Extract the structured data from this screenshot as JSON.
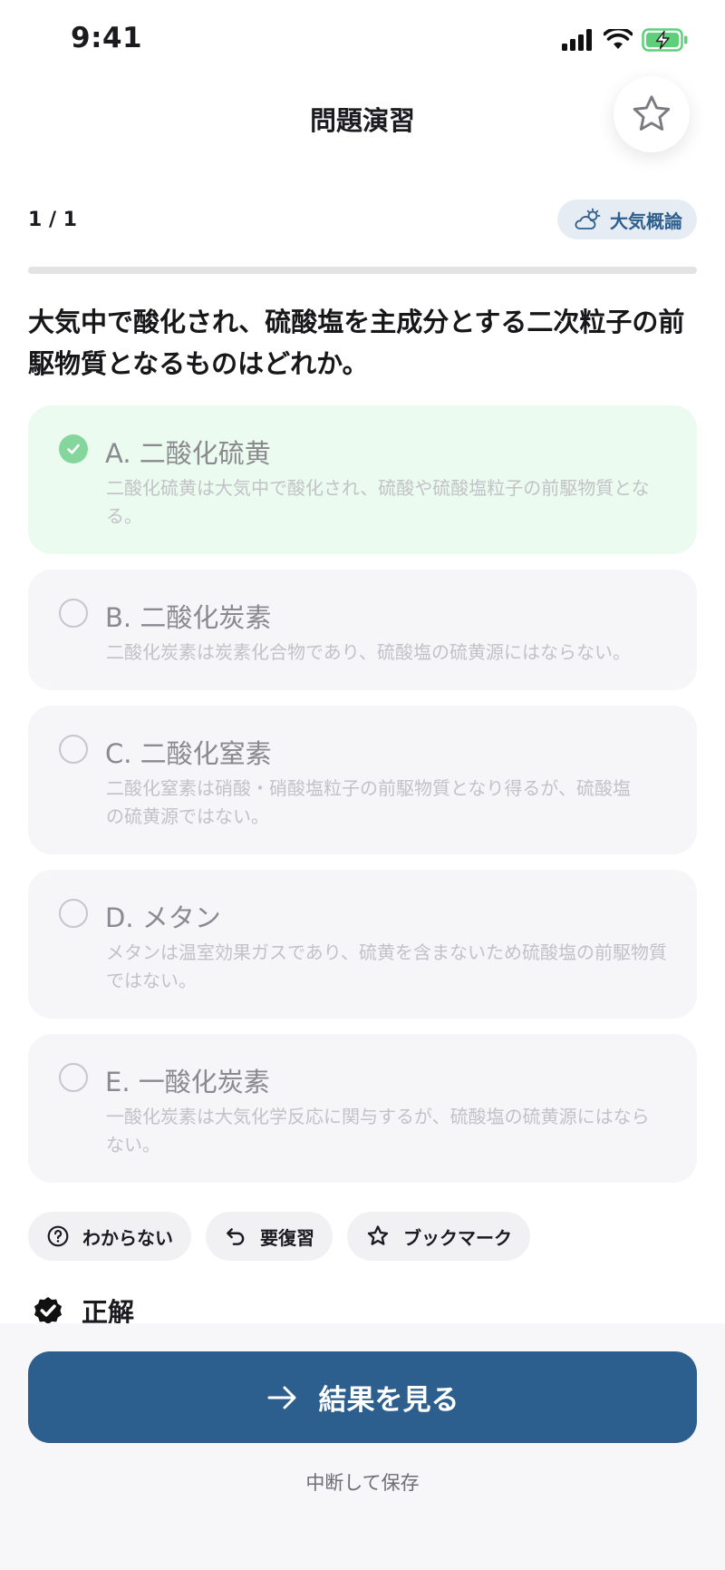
{
  "status_bar": {
    "time": "9:41"
  },
  "nav": {
    "title": "問題演習",
    "bookmark_icon": "star-outline-icon"
  },
  "progress": {
    "count": "1 / 1",
    "fraction": 1.0
  },
  "category": {
    "label": "大気概論",
    "icon": "cloud-sun-icon"
  },
  "question": {
    "text": "大気中で酸化され、硫酸塩を主成分とする二次粒子の前駆物質となるものはどれか。"
  },
  "options": [
    {
      "title": "A. 二酸化硫黄",
      "explanation": "二酸化硫黄は大気中で酸化され、硫酸や硫酸塩粒子の前駆物質となる。",
      "correct": true
    },
    {
      "title": "B. 二酸化炭素",
      "explanation": "二酸化炭素は炭素化合物であり、硫酸塩の硫黄源にはならない。",
      "correct": false
    },
    {
      "title": "C. 二酸化窒素",
      "explanation": "二酸化窒素は硝酸・硝酸塩粒子の前駆物質となり得るが、硫酸塩の硫黄源ではない。",
      "correct": false
    },
    {
      "title": "D. メタン",
      "explanation": "メタンは温室効果ガスであり、硫黄を含まないため硫酸塩の前駆物質ではない。",
      "correct": false
    },
    {
      "title": "E. 一酸化炭素",
      "explanation": "一酸化炭素は大気化学反応に関与するが、硫酸塩の硫黄源にはならない。",
      "correct": false
    }
  ],
  "actions": {
    "unknown_label": "わからない",
    "review_label": "要復習",
    "bookmark_label": "ブックマーク"
  },
  "result": {
    "label": "正解"
  },
  "footer": {
    "cta_label": "結果を見る",
    "save_label": "中断して保存"
  },
  "colors": {
    "primary": "#2c5f8d",
    "correct_bg": "#ebfbef",
    "correct_check": "#84d69c",
    "chip_bg": "#e5ecf4",
    "chip_text": "#2f5f8c"
  }
}
